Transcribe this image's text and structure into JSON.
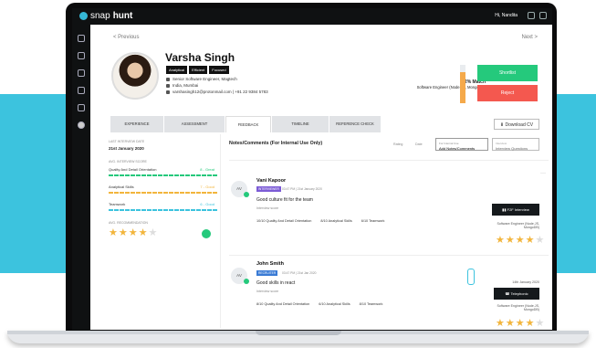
{
  "app": {
    "logo_text_a": "snap",
    "logo_text_b": "hunt",
    "user_greeting": "Hi, Nandita"
  },
  "nav": {
    "previous": "< Previous",
    "next": "Next >"
  },
  "candidate": {
    "name": "Varsha Singh",
    "tags": [
      "Analytical",
      "Efficient",
      "Focused"
    ],
    "title": "Senior Software Engineer, Magtech",
    "location": "India, Mumbai",
    "contact": "varshasingh12@protonmail.com | +91 22 9384 5783",
    "match_percent": "82% Match",
    "match_role": "Software Engineer (Node.JS, MongoDB)",
    "match_fraction": 0.82
  },
  "actions": {
    "shortlist": "Shortlist",
    "reject": "Reject",
    "download_cv": "Download CV"
  },
  "tabs": [
    {
      "label": "EXPERIENCE",
      "active": false
    },
    {
      "label": "ASSESSMENT",
      "active": false
    },
    {
      "label": "FEEDBACK",
      "active": true
    },
    {
      "label": "TIMELINE",
      "active": false
    },
    {
      "label": "REFERENCE CHECK",
      "active": false
    }
  ],
  "summary": {
    "last_interview_label": "LAST INTERVIEW DATE",
    "last_interview_date": "21st January 2020",
    "avg_score_label": "AVG. INTERVIEW SCORE",
    "scores": [
      {
        "label": "Quality And Detail Orientation",
        "value": "8 - Great",
        "color": "#25c97c"
      },
      {
        "label": "Analytical Skills",
        "value": "7 - Good",
        "color": "#f2b53c"
      },
      {
        "label": "Teamwork",
        "value": "6 - Good",
        "color": "#3cc3de"
      }
    ],
    "avg_recommendation_label": "AVG. RECOMMENDATION",
    "recommendation_stars": 4
  },
  "notes": {
    "title": "Notes/Comments (For Internal Use Only)",
    "filter_rating": "Rating",
    "filter_date": "Date",
    "add_button_small": "For Internal Use",
    "add_button": "Add Notes/Comments",
    "interview_questions_small": "Interview",
    "interview_questions": "Interview Questions",
    "items": [
      {
        "initials": "AV",
        "author": "Vani Kapoor",
        "badge": "INTERVIEWER",
        "badge_color": "#7c5cd6",
        "time": "03:47 PM | 21st January 2020",
        "text": "Good culture fit for the team",
        "sub": "Interview score",
        "scores": [
          "10/10 Quality And Detail Orientation",
          "8/10 Analytical Skills",
          "6/10 Teamwork"
        ],
        "meeting_type": "F2F Interview",
        "role": "Software Engineer (Node.JS, MongoDB)",
        "stars": 4
      },
      {
        "initials": "AV",
        "author": "John Smith",
        "badge": "RECRUITER",
        "badge_color": "#3a7bd5",
        "time": "03:47 PM | 21st Jan 2020",
        "text": "Good skills in react",
        "sub": "Interview score",
        "scores": [
          "8/10 Quality And Detail Orientation",
          "6/10 Analytical Skills",
          "8/10 Teamwork"
        ],
        "date": "14th January 2020",
        "meeting_type": "Telephonic",
        "role": "Software Engineer (Node.JS, MongoDB)",
        "stars": 4
      }
    ]
  }
}
